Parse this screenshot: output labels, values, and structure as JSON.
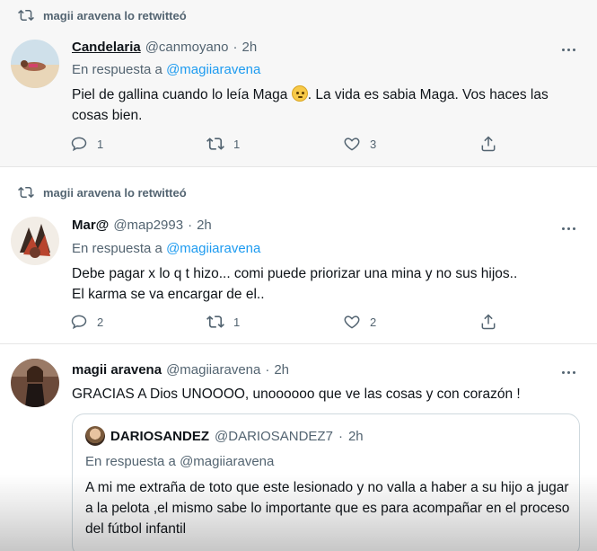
{
  "tweets": [
    {
      "retweet_label": "magii aravena lo retwitteó",
      "name": "Candelaria",
      "handle": "@canmoyano",
      "separator": "·",
      "time": "2h",
      "reply_prefix": "En respuesta a",
      "reply_to": "@magiiaravena",
      "text_part1": "Piel de gallina cuando lo leía Maga",
      "text_part2": ". La vida es sabia Maga. Vos haces las cosas bien.",
      "emoji_icon": "thinking-face-emoji",
      "replies": "1",
      "retweets": "1",
      "likes": "3"
    },
    {
      "retweet_label": "magii aravena lo retwitteó",
      "name": "Mar@",
      "handle": "@map2993",
      "separator": "·",
      "time": "2h",
      "reply_prefix": "En respuesta a",
      "reply_to": "@magiiaravena",
      "text_line1": "Debe pagar x lo q t hizo... comi puede priorizar una mina y no sus hijos..",
      "text_line2": "El karma se va encargar de el..",
      "replies": "2",
      "retweets": "1",
      "likes": "2"
    },
    {
      "name": "magii aravena",
      "handle": "@magiiaravena",
      "separator": "·",
      "time": "2h",
      "text": "GRACIAS A Dios UNOOOO, unoooooo que ve las cosas y con corazón !",
      "quote": {
        "name": "DARIOSANDEZ",
        "handle": "@DARIOSANDEZ7",
        "separator": "·",
        "time": "2h",
        "reply_line": "En respuesta a @magiiaravena",
        "text": "A mi me extraña de toto que este lesionado y no valla a haber a su hijo a jugar a la pelota ,el mismo sabe lo importante que es para acompañar en el proceso del fútbol infantil"
      }
    }
  ],
  "icons": {
    "retweet": "retweet-icon",
    "reply": "reply-icon",
    "like": "heart-icon",
    "share": "share-icon",
    "more": "more-options-icon"
  },
  "colors": {
    "link": "#1d9bf0",
    "secondary_text": "#536471",
    "primary_text": "#0f1419"
  }
}
